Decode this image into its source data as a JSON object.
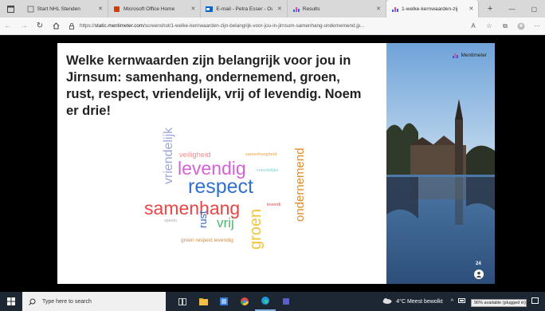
{
  "browser": {
    "tabs": [
      {
        "label": "Start NHL Stenden",
        "active": false
      },
      {
        "label": "Microsoft Office Home",
        "active": false
      },
      {
        "label": "E-mail - Petra Esser - Outl",
        "active": false
      },
      {
        "label": "Results",
        "active": false
      },
      {
        "label": "1-welke-kernwaarden-zij",
        "active": true
      }
    ],
    "new_tab_label": "+",
    "url_prefix": "https://",
    "url_host": "static.mentimeter.com",
    "url_path": "/screenshot/1-welke-kernwaarden-zijn-belangrijk-voor-jou-in-jirnsum-samenhang-ondernemend.jp..."
  },
  "slide": {
    "title": "Welke kernwaarden zijn belangrijk voor jou in Jirnsum: samenhang, ondernemend, groen, rust, respect, vriendelijk, vrij of levendig. Noem er drie!",
    "brand": "Mentimeter",
    "participant_count": "24",
    "words": [
      {
        "text": "vriendelijk",
        "color": "#9ba7dd"
      },
      {
        "text": "veiligheid",
        "color": "#f08f8f"
      },
      {
        "text": "levendig",
        "color": "#d861d9"
      },
      {
        "text": "samenhangheid",
        "color": "#e8a33b"
      },
      {
        "text": "vriendelijke",
        "color": "#7bd3cf"
      },
      {
        "text": "respect",
        "color": "#2f6fcf"
      },
      {
        "text": "samenhang",
        "color": "#e84545"
      },
      {
        "text": "speels",
        "color": "#aaaaaa"
      },
      {
        "text": "rust",
        "color": "#3d68c0"
      },
      {
        "text": "vrij",
        "color": "#4cb96c"
      },
      {
        "text": "groen",
        "color": "#f0c43a"
      },
      {
        "text": "levendi",
        "color": "#e84545"
      },
      {
        "text": "groen respect levendig",
        "color": "#d8893a"
      },
      {
        "text": "ondernemend",
        "color": "#e08e2b"
      }
    ]
  },
  "taskbar": {
    "search_placeholder": "Type here to search",
    "weather": "4°C  Meest bewolkt",
    "battery_tooltip": "96% available (plugged in)"
  }
}
